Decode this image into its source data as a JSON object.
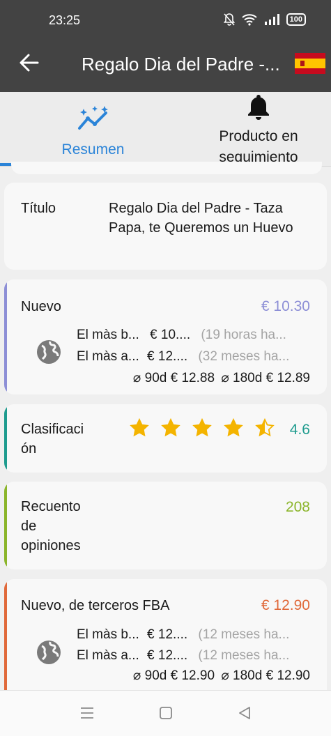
{
  "status_bar": {
    "time": "23:25",
    "battery": "100"
  },
  "app_bar": {
    "title": "Regalo Dia del Padre -...",
    "flag": "spain-flag"
  },
  "tabs": [
    {
      "label": "Resumen",
      "icon": "trending-icon",
      "selected": true
    },
    {
      "label_line1": "Producto en",
      "label_line2": "seguimiento",
      "icon": "bell-icon",
      "selected": false
    }
  ],
  "title_card": {
    "label": "Título",
    "value": "Regalo Dia del Padre - Taza Papa, te Queremos un Huevo"
  },
  "nuevo_card": {
    "label": "Nuevo",
    "price": "€ 10.30",
    "accent": "#8d8fd6",
    "low_label": "El màs b...",
    "low_price": "€ 10....",
    "low_when": "(19 horas ha...",
    "high_label": "El màs a...",
    "high_price": "€ 12....",
    "high_when": "(32 meses ha...",
    "avg90_label": "⌀ 90d",
    "avg90": "€ 12.88",
    "avg180_label": "⌀ 180d",
    "avg180": "€ 12.89"
  },
  "rating_card": {
    "label_line1": "Clasificaci",
    "label_line2": "ón",
    "rating": 4.6,
    "rating_text": "4.6",
    "accent": "#1e9b8e"
  },
  "reviews_card": {
    "label_line1": "Recuento",
    "label_line2": "de",
    "label_line3": "opiniones",
    "count": "208",
    "accent": "#8bb52a"
  },
  "fba_card": {
    "label": "Nuevo, de terceros FBA",
    "price": "€ 12.90",
    "accent": "#e0693a",
    "low_label": "El màs b...",
    "low_price": "€ 12....",
    "low_when": "(12 meses ha...",
    "high_label": "El màs a...",
    "high_price": "€ 12....",
    "high_when": "(12 meses ha...",
    "avg90_label": "⌀ 90d",
    "avg90": "€ 12.90",
    "avg180_label": "⌀ 180d",
    "avg180": "€ 12.90"
  },
  "nav_bar": {
    "buttons": [
      "menu-icon",
      "home-icon",
      "back-triangle-icon"
    ]
  }
}
